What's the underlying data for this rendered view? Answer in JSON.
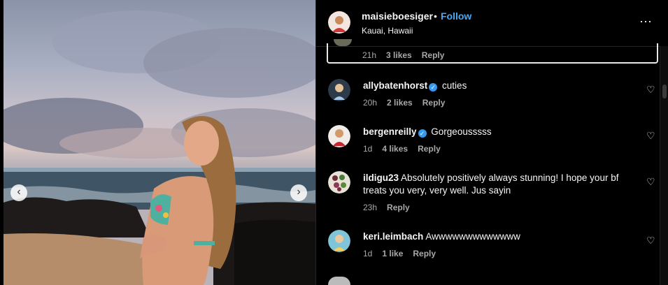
{
  "post": {
    "username": "maisieboesiger",
    "separator": "•",
    "follow_label": "Follow",
    "location": "Kauai, Hawaii",
    "more_icon": "⋯",
    "prev_icon": "‹",
    "next_icon": "›"
  },
  "selected_comment": {
    "time": "21h",
    "likes": "3 likes",
    "reply": "Reply"
  },
  "comments": [
    {
      "username": "allybatenhorst",
      "verified": true,
      "text": "cuties",
      "time": "20h",
      "likes": "2 likes",
      "reply": "Reply"
    },
    {
      "username": "bergenreilly",
      "verified": true,
      "text": "Gorgeousssss",
      "time": "1d",
      "likes": "4 likes",
      "reply": "Reply"
    },
    {
      "username": "ildigu23",
      "verified": false,
      "text": "Absolutely positively always stunning! I hope your bf treats you very, very well. Jus sayin",
      "time": "23h",
      "likes": "",
      "reply": "Reply"
    },
    {
      "username": "keri.leimbach",
      "verified": false,
      "text": "Awwwwwwwwwwwww",
      "time": "1d",
      "likes": "1 like",
      "reply": "Reply"
    }
  ],
  "icons": {
    "heart": "♡",
    "verified": "✓"
  },
  "colors": {
    "accent": "#4aa8f5",
    "verified": "#3897f0",
    "background": "#000000",
    "muted": "#a8a8a8"
  }
}
